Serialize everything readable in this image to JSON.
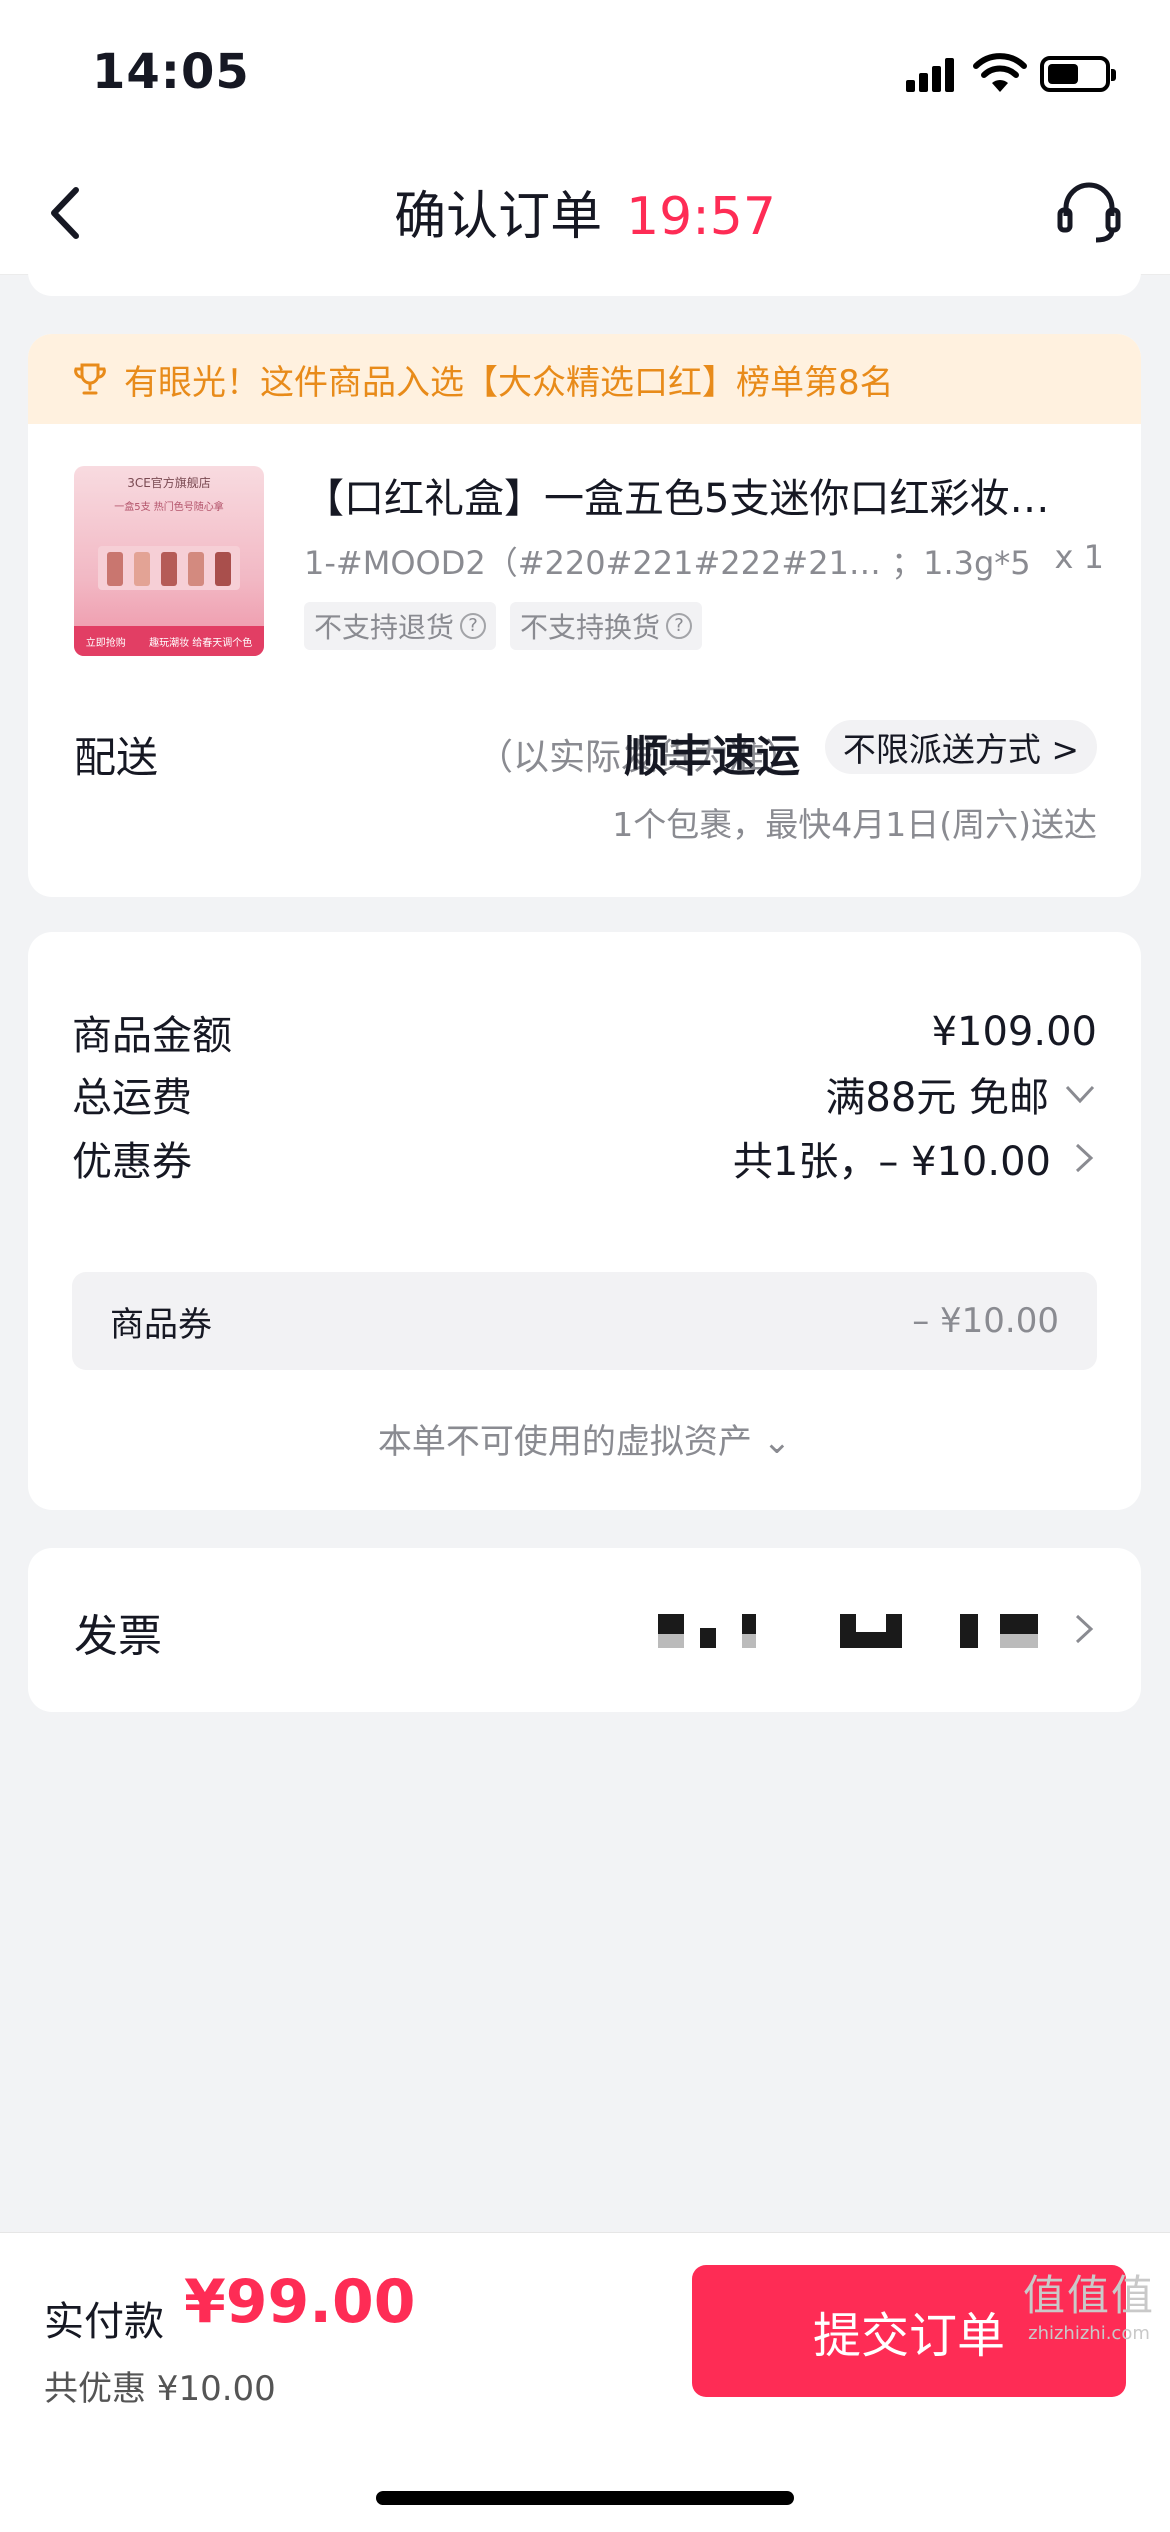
{
  "status_bar": {
    "time": "14:05"
  },
  "nav": {
    "title": "确认订单",
    "countdown": "19:57"
  },
  "rank_banner": {
    "text": "有眼光！这件商品入选【大众精选口红】榜单第8名"
  },
  "product": {
    "title": "【口红礼盒】一盒五色5支迷你口红彩妆…",
    "spec": "1-#MOOD2（#220#221#222#21… ；1.3g*5",
    "qty": "x 1",
    "tags": [
      "不支持退货",
      "不支持换货"
    ],
    "thumb": {
      "shop": "3CE官方旗舰店",
      "tagline": "一盒5支 热门色号随心拿",
      "strip": [
        "立即抢购",
        "趣玩潮妆 给春天调个色"
      ]
    }
  },
  "shipping": {
    "label": "配送",
    "note": "（以实际发货为准）",
    "carrier": "顺丰速运",
    "method": "不限派送方式 >",
    "eta": "1个包裹，最快4月1日(周六)送达"
  },
  "prices": {
    "goods_label": "商品金额",
    "goods_value": "¥109.00",
    "freight_label": "总运费",
    "freight_value": "满88元 免邮",
    "coupon_label": "优惠券",
    "coupon_value": "共1张，– ¥10.00",
    "coupon_sub_label": "商品券",
    "coupon_sub_value": "– ¥10.00",
    "unusable_text": "本单不可使用的虚拟资产 ⌄"
  },
  "invoice": {
    "label": "发票"
  },
  "footer": {
    "pay_label": "实付款",
    "pay_amount": "¥99.00",
    "discount": "共优惠 ¥10.00",
    "submit_label": "提交订单"
  },
  "watermark": {
    "logo": "值值值",
    "url": "zhizhizhi.com"
  },
  "colors": {
    "accent": "#fe2c55",
    "banner_text": "#e88b1a",
    "banner_bg": "#fff1df",
    "muted": "#8a8b91",
    "page_bg": "#f2f3f5"
  }
}
